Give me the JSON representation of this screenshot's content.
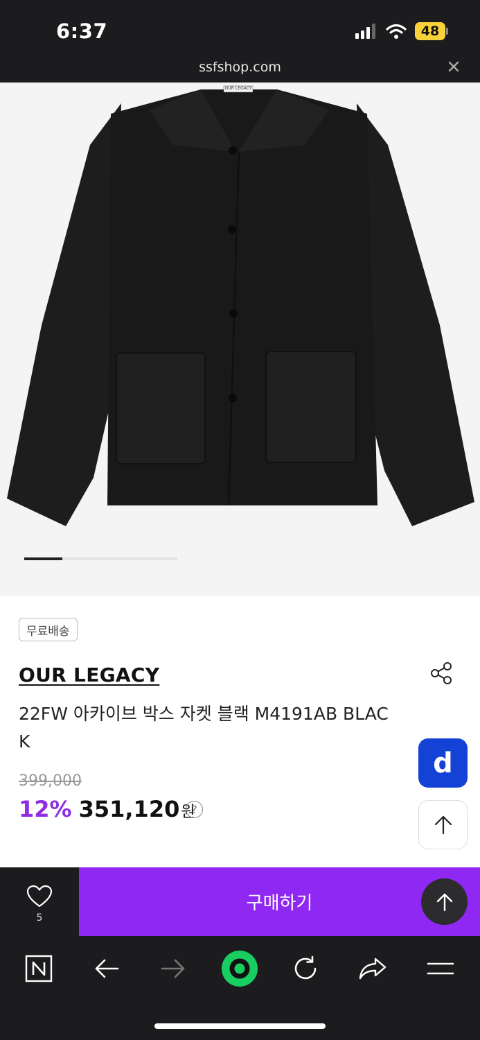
{
  "status_bar": {
    "time": "6:37",
    "battery": "48"
  },
  "browser": {
    "url": "ssfshop.com"
  },
  "product_image": {
    "label_text": "OUR LEGACY",
    "carousel_progress": 0.25
  },
  "product": {
    "badge": "무료배송",
    "brand": "OUR LEGACY",
    "title": "22FW 아카이브 박스 자켓 블랙 M4191AB BLACK",
    "original_price": "399,000",
    "discount": "12%",
    "price": "351,120",
    "currency": "원",
    "help": "?"
  },
  "floating": {
    "d_label": "d"
  },
  "action_bar": {
    "like_count": "5",
    "buy_label": "구매하기"
  },
  "colors": {
    "accent": "#8f28f3",
    "discount": "#8e2de2",
    "d_button": "#1442d6",
    "dark_bar": "#1c1c1e",
    "naver_green": "#19ce60"
  },
  "icons": [
    "signal-icon",
    "wifi-icon",
    "battery-icon",
    "close-icon",
    "share-icon",
    "help-icon",
    "arrow-up-icon",
    "heart-icon",
    "naver-n-icon",
    "back-arrow-icon",
    "forward-arrow-icon",
    "green-dot-icon",
    "refresh-icon",
    "share-forward-icon",
    "menu-icon"
  ]
}
